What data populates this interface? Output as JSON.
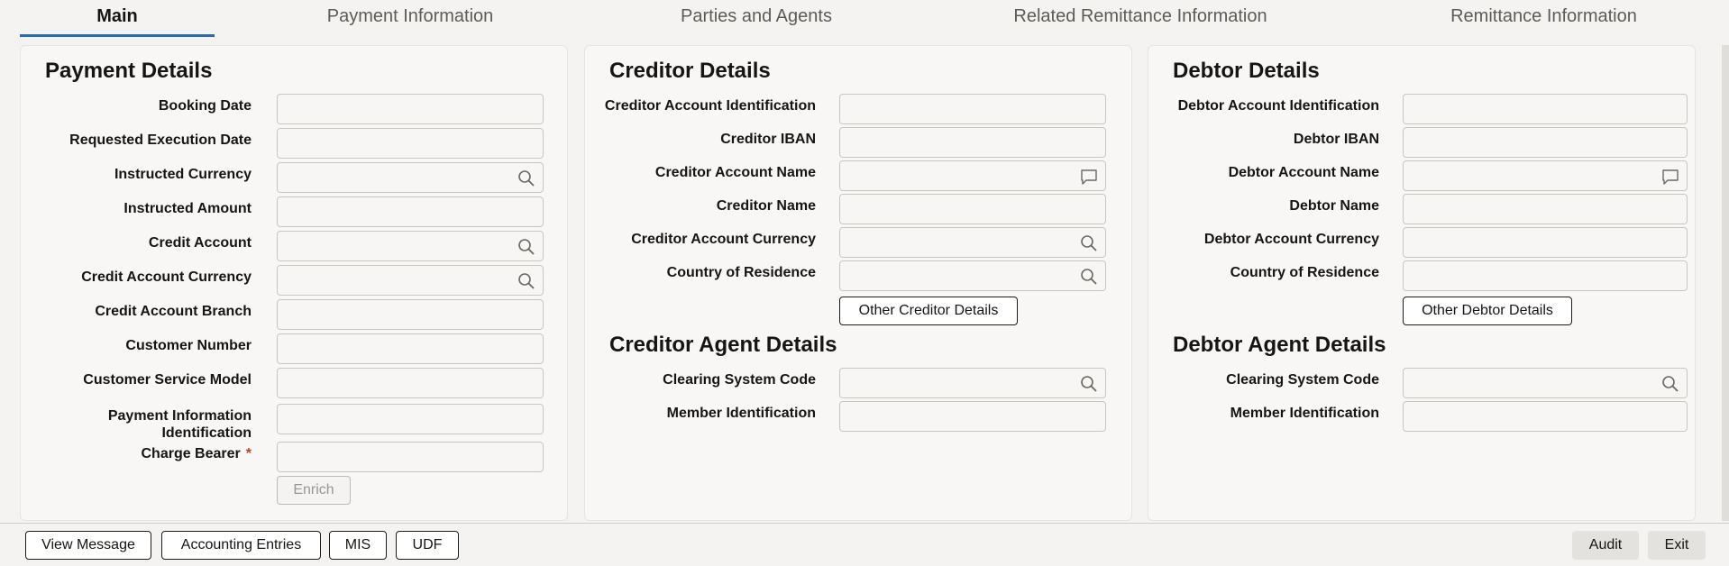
{
  "tabs": [
    "Main",
    "Payment Information",
    "Parties and Agents",
    "Related Remittance Information",
    "Remittance Information"
  ],
  "payment": {
    "title": "Payment Details",
    "labels": [
      "Booking Date",
      "Requested Execution Date",
      "Instructed Currency",
      "Instructed Amount",
      "Credit Account",
      "Credit Account Currency",
      "Credit Account Branch",
      "Customer Number",
      "Customer Service Model",
      "Payment Information",
      "Identification",
      "Charge Bearer"
    ],
    "required_mark": "*",
    "enrich": "Enrich"
  },
  "creditor": {
    "title": "Creditor Details",
    "labels": [
      "Creditor Account Identification",
      "Creditor IBAN",
      "Creditor Account Name",
      "Creditor Name",
      "Creditor Account Currency",
      "Country of Residence"
    ],
    "other_button": "Other Creditor Details",
    "agent_title": "Creditor Agent Details",
    "agent_labels": [
      "Clearing System Code",
      "Member Identification"
    ]
  },
  "debtor": {
    "title": "Debtor Details",
    "labels": [
      "Debtor Account Identification",
      "Debtor IBAN",
      "Debtor Account Name",
      "Debtor Name",
      "Debtor Account Currency",
      "Country of Residence"
    ],
    "other_button": "Other Debtor Details",
    "agent_title": "Debtor Agent Details",
    "agent_labels": [
      "Clearing System Code",
      "Member Identification"
    ]
  },
  "footer": {
    "view_message": "View Message",
    "accounting_entries": "Accounting Entries",
    "mis": "MIS",
    "udf": "UDF",
    "audit": "Audit",
    "exit": "Exit"
  },
  "icons": {
    "search": "search-icon",
    "comment": "comment-icon"
  }
}
